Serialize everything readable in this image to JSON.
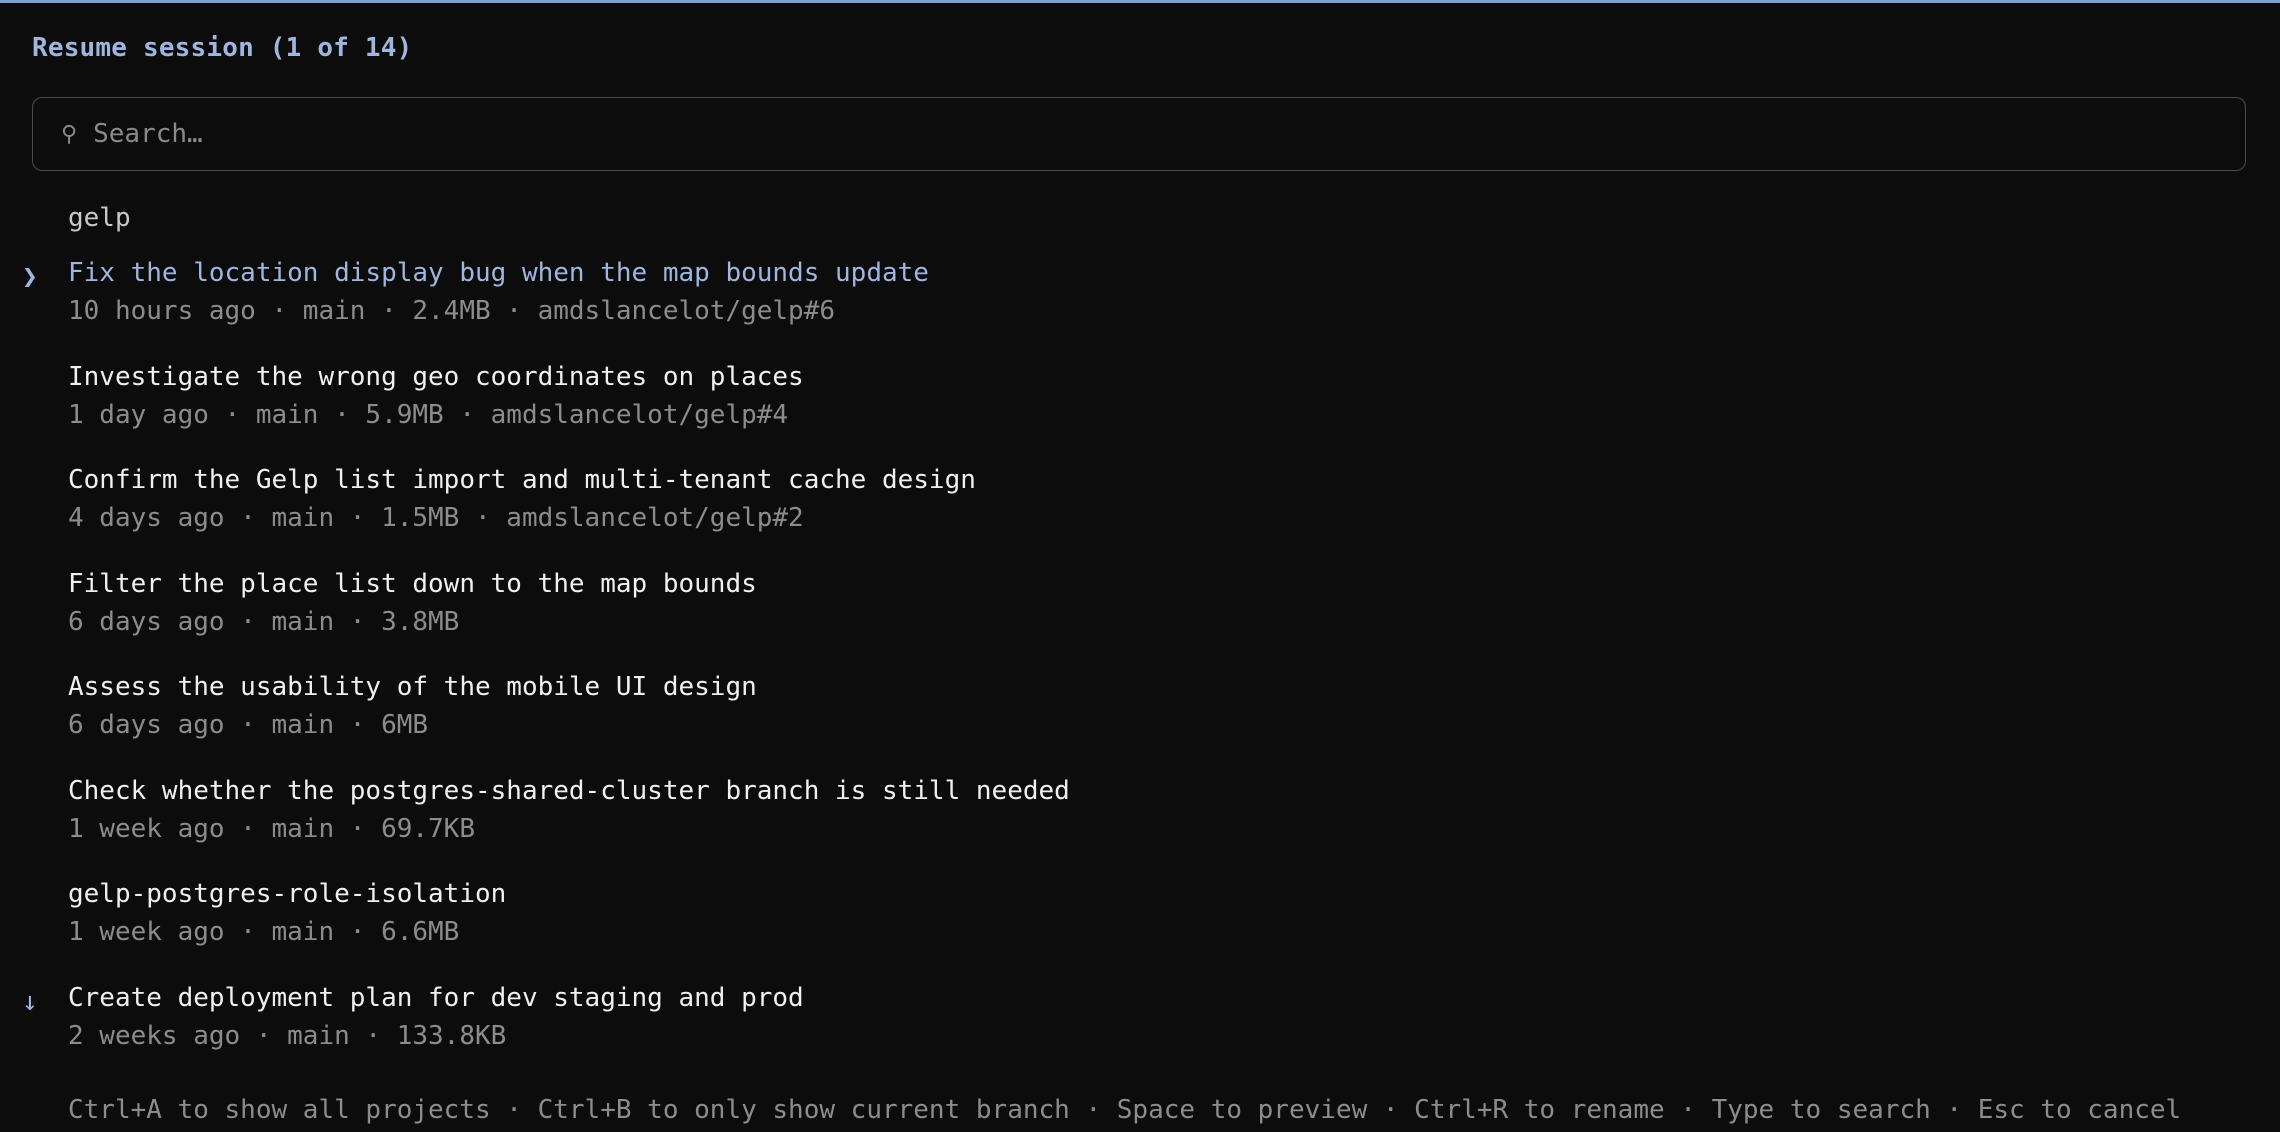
{
  "title": "Resume session (1 of 14)",
  "search": {
    "icon": "search-icon",
    "placeholder": "Search…",
    "value": ""
  },
  "project": "gelp",
  "selected_marker": "❯",
  "more_marker": "↓",
  "sessions": [
    {
      "title": "Fix the location display bug when the map bounds update",
      "meta": "10 hours ago · main · 2.4MB · amdslancelot/gelp#6"
    },
    {
      "title": "Investigate the wrong geo coordinates on places",
      "meta": "1 day ago · main · 5.9MB · amdslancelot/gelp#4"
    },
    {
      "title": "Confirm the Gelp list import and multi-tenant cache design",
      "meta": "4 days ago · main · 1.5MB · amdslancelot/gelp#2"
    },
    {
      "title": "Filter the place list down to the map bounds",
      "meta": "6 days ago · main · 3.8MB"
    },
    {
      "title": "Assess the usability of the mobile UI design",
      "meta": "6 days ago · main · 6MB"
    },
    {
      "title": "Check whether the postgres-shared-cluster branch is still needed",
      "meta": "1 week ago · main · 69.7KB"
    },
    {
      "title": "gelp-postgres-role-isolation",
      "meta": "1 week ago · main · 6.6MB"
    },
    {
      "title": "Create deployment plan for dev staging and prod",
      "meta": "2 weeks ago · main · 133.8KB"
    }
  ],
  "footer": "Ctrl+A to show all projects · Ctrl+B to only show current branch · Space to preview · Ctrl+R to rename · Type to search · Esc to cancel",
  "colors": {
    "accent": "#9fb6de",
    "background": "#0c0c0c",
    "muted": "#8c8c8c",
    "text": "#f0f0f0"
  }
}
